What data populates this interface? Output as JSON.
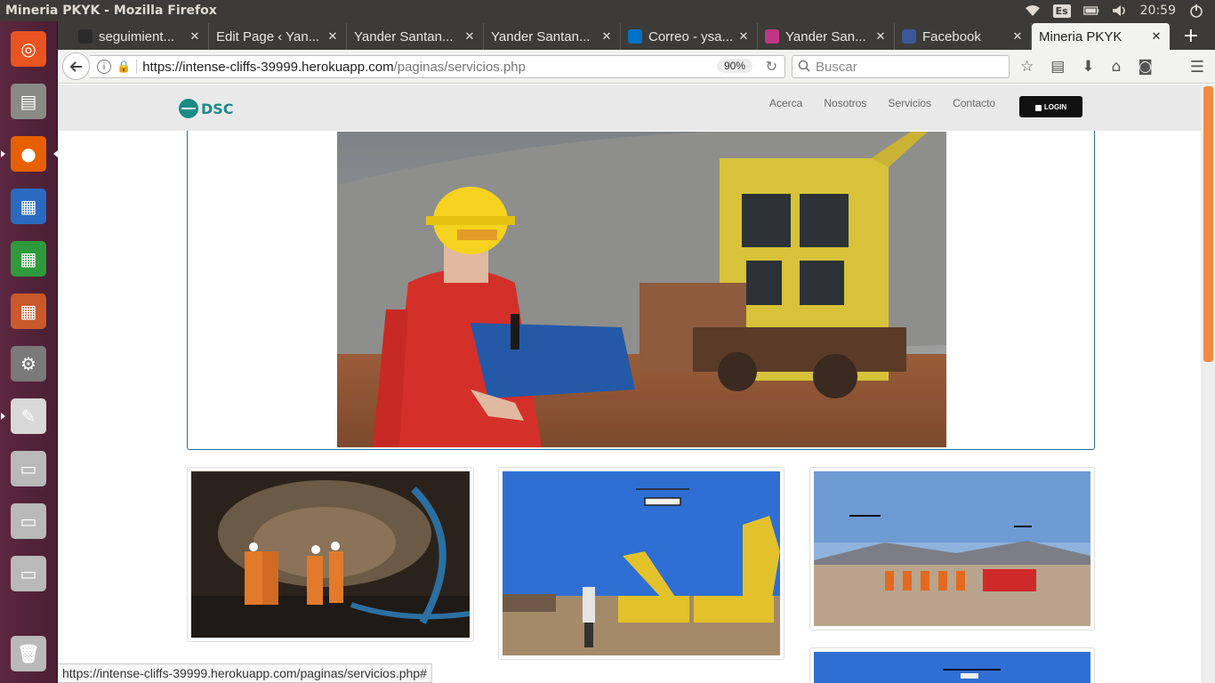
{
  "os": {
    "window_title": "Mineria PKYK - Mozilla Firefox",
    "keyboard_layout": "Es",
    "clock": "20:59"
  },
  "launcher": {
    "apps": [
      {
        "name": "ubuntu-dash-icon",
        "glyph": "◎",
        "color": "#e95420"
      },
      {
        "name": "file-manager-icon",
        "glyph": "▤",
        "color": "#8a8a85"
      },
      {
        "name": "firefox-icon",
        "glyph": "●",
        "color": "#e66000"
      },
      {
        "name": "writer-icon",
        "glyph": "▦",
        "color": "#2a6bbf"
      },
      {
        "name": "calc-icon",
        "glyph": "▦",
        "color": "#2e9a3b"
      },
      {
        "name": "impress-icon",
        "glyph": "▦",
        "color": "#c9582b"
      },
      {
        "name": "system-settings-icon",
        "glyph": "⚙",
        "color": "#7a7a7a"
      },
      {
        "name": "document-viewer-icon",
        "glyph": "✎",
        "color": "#d8d8d8"
      },
      {
        "name": "drive-icon-1",
        "glyph": "▭",
        "color": "#b9b9b9"
      },
      {
        "name": "drive-icon-2",
        "glyph": "▭",
        "color": "#b9b9b9"
      },
      {
        "name": "drive-icon-3",
        "glyph": "▭",
        "color": "#b9b9b9"
      },
      {
        "name": "trash-icon",
        "glyph": "🗑",
        "color": "#b9b9b9"
      }
    ]
  },
  "browser": {
    "tabs": [
      {
        "label": "seguimient...",
        "favicon_color": "#2b2b2b"
      },
      {
        "label": "Edit Page ‹ Yan...",
        "favicon_color": ""
      },
      {
        "label": "Yander Santan...",
        "favicon_color": ""
      },
      {
        "label": "Yander Santan...",
        "favicon_color": ""
      },
      {
        "label": "Correo - ysa...",
        "favicon_color": "#0072c6"
      },
      {
        "label": "Yander San...",
        "favicon_color": "#c13584"
      },
      {
        "label": "Facebook",
        "favicon_color": "#3b5998"
      },
      {
        "label": "Mineria PKYK",
        "favicon_color": ""
      }
    ],
    "close_glyph": "✕",
    "new_tab_glyph": "+",
    "url_host": "https://intense-cliffs-39999.herokuapp.com",
    "url_path": "/paginas/servicios.php",
    "zoom": "90%",
    "search_placeholder": "Buscar",
    "status_url": "https://intense-cliffs-39999.herokuapp.com/paginas/servicios.php#"
  },
  "site": {
    "logo_text": "DSC",
    "nav": [
      "Acerca",
      "Nosotros",
      "Servicios",
      "Contacto"
    ],
    "login_label": "LOGIN",
    "accent_color": "#2b6aa6",
    "scroll_color": "#f28a45"
  }
}
